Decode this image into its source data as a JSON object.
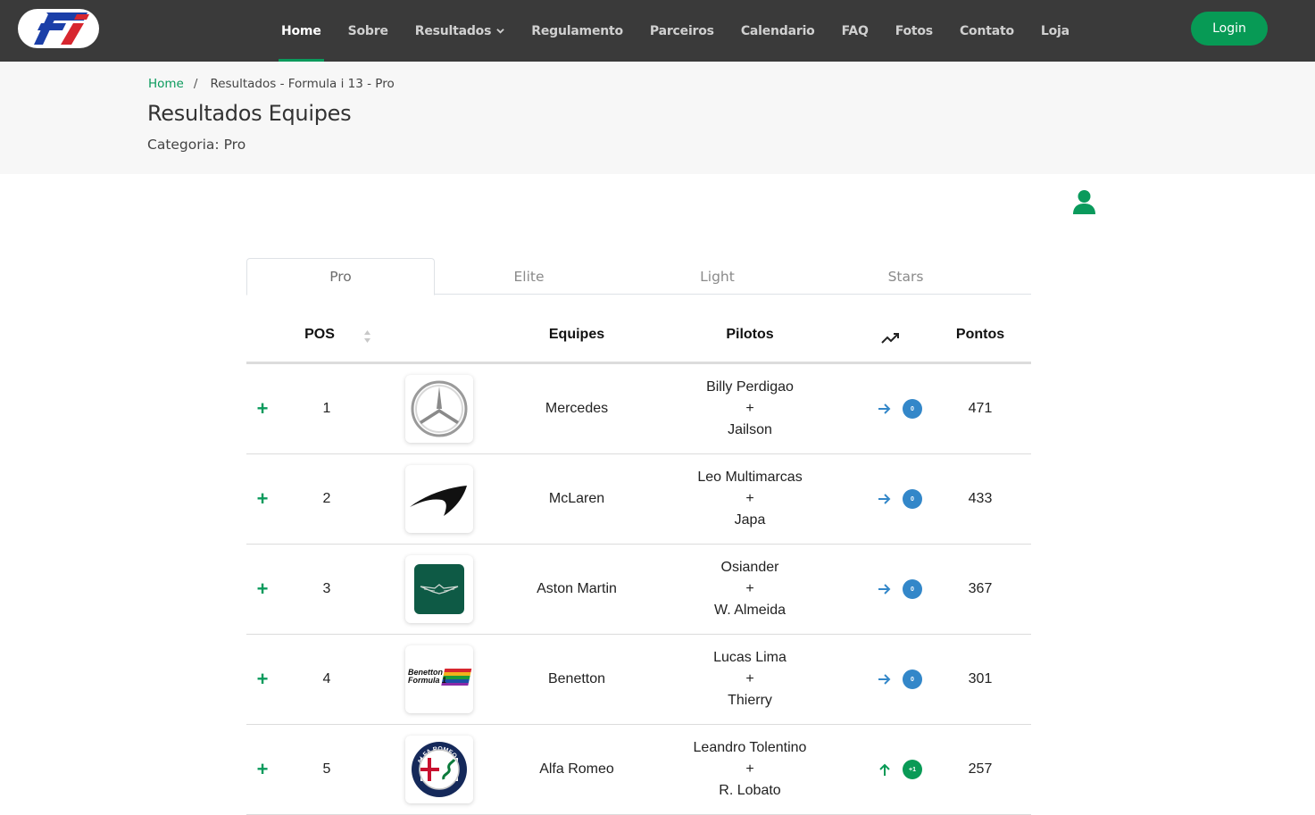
{
  "navbar": {
    "items": [
      {
        "label": "Home",
        "active": true
      },
      {
        "label": "Sobre"
      },
      {
        "label": "Resultados",
        "dropdown": true
      },
      {
        "label": "Regulamento"
      },
      {
        "label": "Parceiros"
      },
      {
        "label": "Calendario"
      },
      {
        "label": "FAQ"
      },
      {
        "label": "Fotos"
      },
      {
        "label": "Contato"
      },
      {
        "label": "Loja"
      }
    ],
    "login_label": "Login"
  },
  "breadcrumb": {
    "home": "Home",
    "separator": "/",
    "current": "Resultados - Formula i 13 - Pro"
  },
  "page": {
    "title": "Resultados Equipes",
    "subtitle": "Categoria: Pro"
  },
  "tabs": [
    {
      "label": "Pro",
      "active": true
    },
    {
      "label": "Elite"
    },
    {
      "label": "Light"
    },
    {
      "label": "Stars"
    }
  ],
  "table": {
    "headers": {
      "pos": "POS",
      "equipes": "Equipes",
      "pilotos": "Pilotos",
      "pontos": "Pontos"
    },
    "rows": [
      {
        "pos": "1",
        "team": "Mercedes",
        "driver1": "Billy Perdigao",
        "joiner": "+",
        "driver2": "Jailson",
        "trend": "same",
        "change": "0",
        "points": "471",
        "logo": "mercedes-logo"
      },
      {
        "pos": "2",
        "team": "McLaren",
        "driver1": "Leo Multimarcas",
        "joiner": "+",
        "driver2": "Japa",
        "trend": "same",
        "change": "0",
        "points": "433",
        "logo": "mclaren-logo"
      },
      {
        "pos": "3",
        "team": "Aston Martin",
        "driver1": "Osiander",
        "joiner": "+",
        "driver2": "W. Almeida",
        "trend": "same",
        "change": "0",
        "points": "367",
        "logo": "aston-martin-logo"
      },
      {
        "pos": "4",
        "team": "Benetton",
        "driver1": "Lucas Lima",
        "joiner": "+",
        "driver2": "Thierry",
        "trend": "same",
        "change": "0",
        "points": "301",
        "logo": "benetton-logo"
      },
      {
        "pos": "5",
        "team": "Alfa Romeo",
        "driver1": "Leandro Tolentino",
        "joiner": "+",
        "driver2": "R. Lobato",
        "trend": "up",
        "change": "+1",
        "points": "257",
        "logo": "alfa-romeo-logo"
      }
    ]
  },
  "logos": {
    "benetton_line1": "Benetton",
    "benetton_line2": "Formula 1",
    "alfa_ring": "ALFA ROMEO"
  },
  "colors": {
    "navbar_bg": "#3a3a3a",
    "accent_green": "#0a9a5c",
    "badge_blue": "#3387c9",
    "header_bg": "#f7f7f7"
  }
}
